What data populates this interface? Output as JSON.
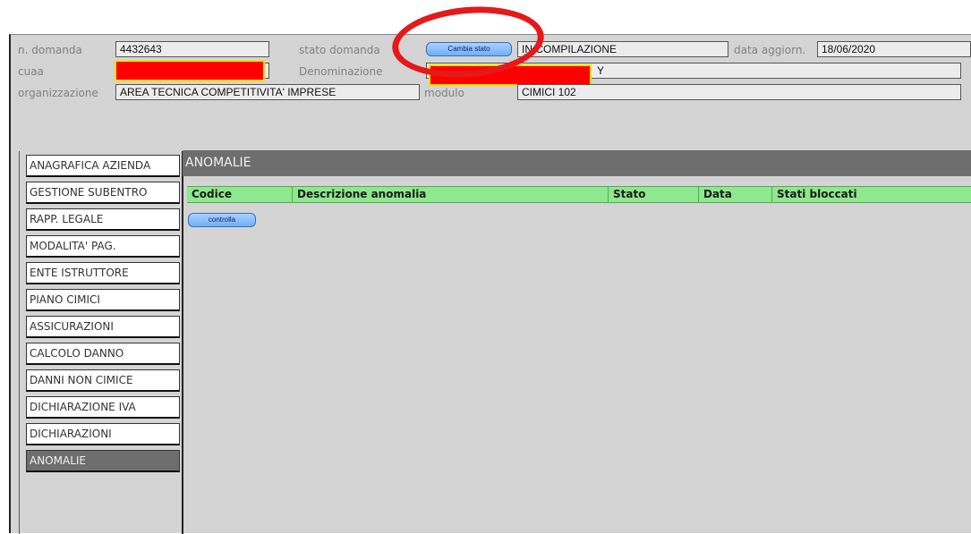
{
  "header": {
    "n_domanda_label": "n. domanda",
    "n_domanda_value": "4432643",
    "stato_domanda_label": "stato domanda",
    "cambia_stato_label": "Cambia stato",
    "stato_value": "IN COMPILAZIONE",
    "data_aggiorn_label": "data aggiorn.",
    "data_aggiorn_value": "18/06/2020",
    "cuaa_label": "cuaa",
    "denominazione_label": "Denominazione",
    "denominazione_tail": "Y",
    "organizzazione_label": "organizzazione",
    "organizzazione_value": "AREA TECNICA COMPETITIVITA' IMPRESE",
    "modulo_label": "modulo",
    "modulo_value": "CIMICI 102"
  },
  "sidebar": {
    "items": [
      {
        "label": "ANAGRAFICA AZIENDA"
      },
      {
        "label": "GESTIONE SUBENTRO"
      },
      {
        "label": "RAPP. LEGALE"
      },
      {
        "label": "MODALITA' PAG."
      },
      {
        "label": "ENTE ISTRUTTORE"
      },
      {
        "label": "PIANO CIMICI"
      },
      {
        "label": "ASSICURAZIONI"
      },
      {
        "label": "CALCOLO DANNO"
      },
      {
        "label": "DANNI NON CIMICE"
      },
      {
        "label": "DICHIARAZIONE IVA"
      },
      {
        "label": "DICHIARAZIONI"
      },
      {
        "label": "ANOMALIE"
      }
    ],
    "active_index": 11
  },
  "main": {
    "section_title": "ANOMALIE",
    "columns": [
      "Codice",
      "Descrizione anomalia",
      "Stato",
      "Data",
      "Stati bloccati"
    ],
    "controlla_label": "controlla"
  },
  "colors": {
    "panel_bg": "#d4d4d4",
    "header_green": "#8ee88e",
    "active_tab": "#6e6e6e",
    "annotation_red": "#e51919",
    "redaction_red": "#ff0000",
    "redaction_border": "#f5e000"
  }
}
